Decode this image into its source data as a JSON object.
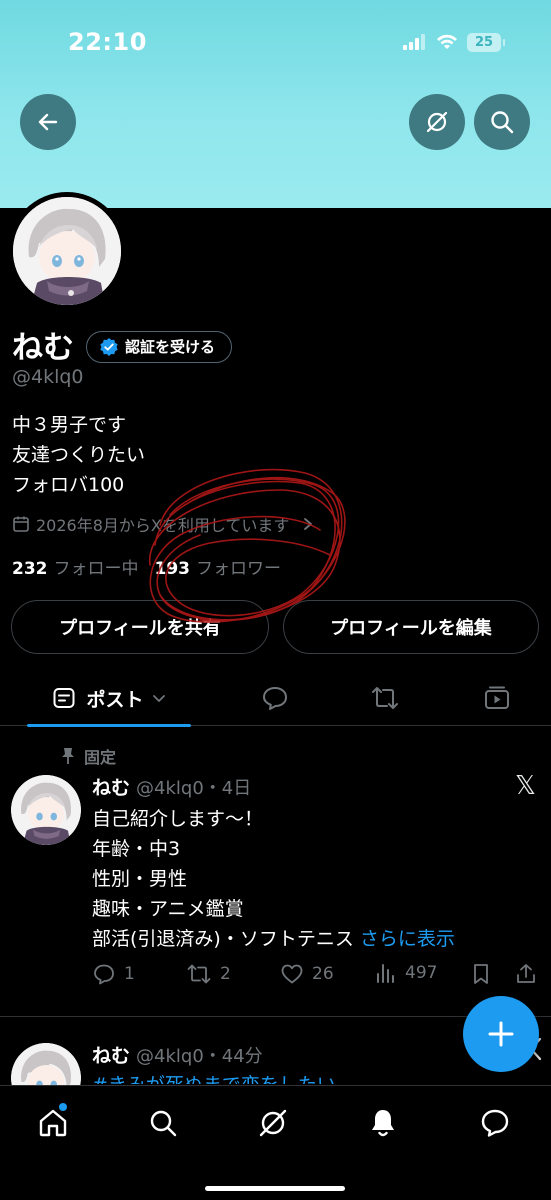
{
  "status_bar": {
    "time": "22:10",
    "battery": "25"
  },
  "header": {
    "back_icon": "arrow-left-icon",
    "grok_icon": "grok-icon",
    "search_icon": "search-icon",
    "banner_color": "#8ee6ec"
  },
  "profile": {
    "display_name": "ねむ",
    "verify_label": "認証を受ける",
    "handle": "@4klq0",
    "bio_lines": [
      "中３男子です",
      "友達つくりたい",
      "フォロバ100"
    ],
    "joined": "2026年8月からXを利用しています",
    "following_count": "232",
    "following_label": "フォロー中",
    "followers_count": "193",
    "followers_label": "フォロワー",
    "share_label": "プロフィールを共有",
    "edit_label": "プロフィールを編集"
  },
  "tabs": {
    "posts_label": "ポスト"
  },
  "pinned_post": {
    "pinned_label": "固定",
    "name": "ねむ",
    "handle_time": "@4klq0・4日",
    "lines": [
      "自己紹介します〜！",
      "年齢・中3",
      "性別・男性",
      "趣味・アニメ鑑賞",
      "部活(引退済み)・ソフトテニス"
    ],
    "more_label": "さらに表示",
    "replies": "1",
    "reposts": "2",
    "likes": "26",
    "views": "497"
  },
  "second_post": {
    "name": "ねむ",
    "handle_time": "@4klq0・44分",
    "text": "#きみが死ぬまで恋をしたい"
  },
  "colors": {
    "accent": "#1d9bf0",
    "scribble": "#b01818"
  }
}
